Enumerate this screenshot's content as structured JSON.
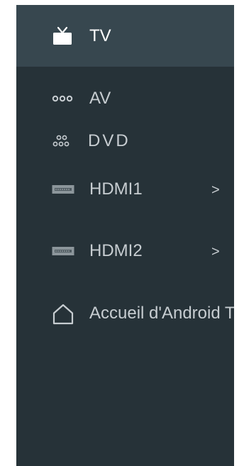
{
  "menu": {
    "items": [
      {
        "label": "TV",
        "icon": "tv-icon",
        "selected": true
      },
      {
        "label": "AV",
        "icon": "av-dots-icon",
        "selected": false
      },
      {
        "label": "DVD",
        "icon": "dvd-dots-icon",
        "selected": false
      },
      {
        "label": "HDMI1",
        "icon": "hdmi-port-icon",
        "chevron": ">",
        "selected": false
      },
      {
        "label": "HDMI2",
        "icon": "hdmi-port-icon",
        "chevron": ">",
        "selected": false
      },
      {
        "label": "Accueil d'Android TV",
        "icon": "home-icon",
        "selected": false
      }
    ]
  },
  "colors": {
    "panel": "#263238",
    "selected": "#37474f",
    "text": "#c7cdd1",
    "selected_text": "#ffffff"
  }
}
